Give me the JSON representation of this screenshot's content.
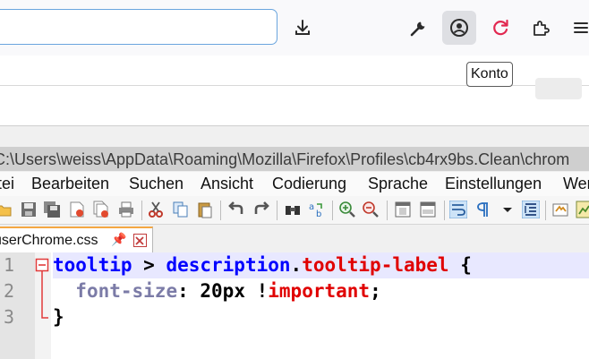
{
  "firefox": {
    "tooltip": "Konto",
    "icons": [
      "download-icon",
      "wrench-icon",
      "account-icon",
      "reload-icon",
      "extensions-icon",
      "menu-icon"
    ],
    "reload_color": "#e22850",
    "focus_color": "#6aa5de"
  },
  "notepad": {
    "title_path": "C:\\Users\\weiss\\AppData\\Roaming\\Mozilla\\Firefox\\Profiles\\cb4rx9bs.Clean\\chrom",
    "menu": [
      "tei",
      "Bearbeiten",
      "Suchen",
      "Ansicht",
      "Codierung",
      "Sprache",
      "Einstellungen",
      "Werk"
    ],
    "tab": {
      "label": "userChrome.css",
      "pin": "📌"
    },
    "line_numbers": [
      "1",
      "2",
      "3"
    ],
    "code": {
      "l1": {
        "sel1": "tooltip",
        "op1": " > ",
        "sel2": "description",
        "dot": ".",
        "cls": "tooltip-label",
        "brace": " {"
      },
      "l2": {
        "indent": "  ",
        "prop": "font-size",
        "colon": ": ",
        "val": "20px ",
        "bang": "!",
        "imp": "important",
        "semi": ";"
      },
      "l3": {
        "brace": "}"
      }
    }
  }
}
